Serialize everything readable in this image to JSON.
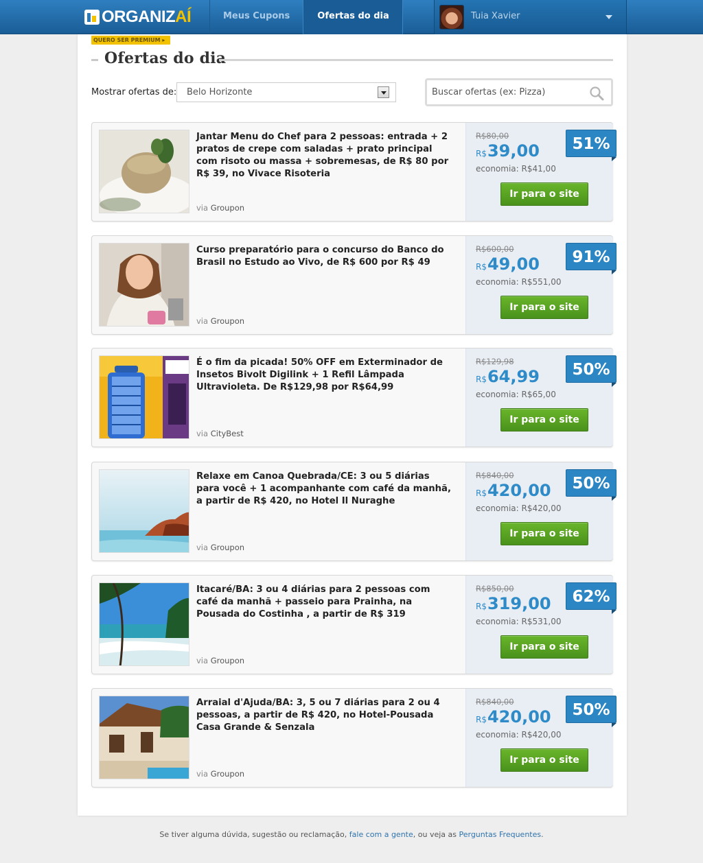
{
  "brand": {
    "name_main": "ORGANIZ",
    "name_accent": "AÍ",
    "premium_label": "QUERO SER PREMIUM ▸"
  },
  "nav": {
    "items": [
      {
        "label": "Meus Cupons"
      },
      {
        "label": "Ofertas do dia"
      }
    ]
  },
  "user": {
    "name": "Tuia Xavier"
  },
  "page": {
    "title": "Ofertas do dia"
  },
  "filter": {
    "label": "Mostrar ofertas de:",
    "city": "Belo Horizonte"
  },
  "search": {
    "placeholder": "Buscar ofertas (ex: Pizza)"
  },
  "offers": [
    {
      "title": "Jantar Menu do Chef para 2 pessoas: entrada + 2 pratos de crepe com saladas + prato principal com risoto ou massa + sobremesas, de R$ 80 por R$ 39, no Vivace Risoteria",
      "via_label": "via",
      "source": "Groupon",
      "old_price": "R$80,00",
      "currency": "R$",
      "price": "39,00",
      "economy": "economia: R$41,00",
      "discount": "51%",
      "button": "Ir para o site"
    },
    {
      "title": "Curso preparatório para o concurso do Banco do Brasil no Estudo ao Vivo, de R$ 600 por R$ 49",
      "via_label": "via",
      "source": "Groupon",
      "old_price": "R$600,00",
      "currency": "R$",
      "price": "49,00",
      "economy": "economia: R$551,00",
      "discount": "91%",
      "button": "Ir para o site"
    },
    {
      "title": "É o fim da picada! 50% OFF em Exterminador de Insetos Bivolt Digilink + 1 Refil Lâmpada Ultravioleta. De R$129,98 por R$64,99",
      "via_label": "via",
      "source": "CityBest",
      "old_price": "R$129,98",
      "currency": "R$",
      "price": "64,99",
      "economy": "economia: R$65,00",
      "discount": "50%",
      "button": "Ir para o site"
    },
    {
      "title": "Relaxe em Canoa Quebrada/CE: 3 ou 5 diárias para você + 1 acompanhante com café da manhã, a partir de R$ 420, no Hotel Il Nuraghe",
      "via_label": "via",
      "source": "Groupon",
      "old_price": "R$840,00",
      "currency": "R$",
      "price": "420,00",
      "economy": "economia: R$420,00",
      "discount": "50%",
      "button": "Ir para o site"
    },
    {
      "title": "Itacaré/BA: 3 ou 4 diárias para 2 pessoas com café da manhã + passeio para Prainha, na Pousada do Costinha , a partir de R$ 319",
      "via_label": "via",
      "source": "Groupon",
      "old_price": "R$850,00",
      "currency": "R$",
      "price": "319,00",
      "economy": "economia: R$531,00",
      "discount": "62%",
      "button": "Ir para o site"
    },
    {
      "title": "Arraial d'Ajuda/BA: 3, 5 ou 7 diárias para 2 ou 4 pessoas, a partir de R$ 420, no Hotel-Pousada Casa Grande & Senzala",
      "via_label": "via",
      "source": "Groupon",
      "old_price": "R$840,00",
      "currency": "R$",
      "price": "420,00",
      "economy": "economia: R$420,00",
      "discount": "50%",
      "button": "Ir para o site"
    }
  ],
  "footer": {
    "text_1": "Se tiver alguma dúvida, sugestão ou reclamação,",
    "link_1": "fale com a gente",
    "text_2": ", ou veja as",
    "link_2": "Perguntas Frequentes",
    "text_3": "."
  }
}
